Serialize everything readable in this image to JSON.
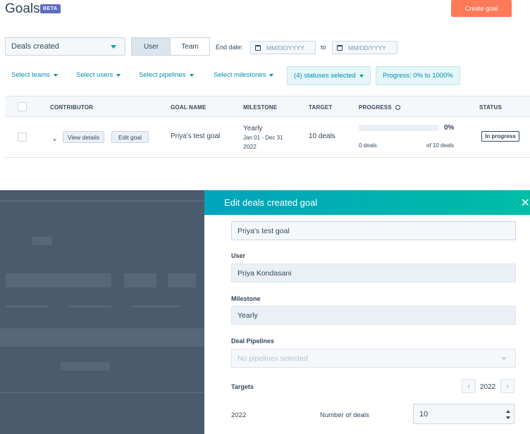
{
  "header": {
    "title": "Goals",
    "badge": "BETA",
    "create_label": "Create goal"
  },
  "filters": {
    "goal_type": "Deals created",
    "segment": {
      "user": "User",
      "team": "Team"
    },
    "end_date_label": "End date:",
    "date_placeholder": "MM/DD/YYYY",
    "to_label": "to",
    "select_teams": "Select teams",
    "select_users": "Select users",
    "select_pipelines": "Select pipelines",
    "select_milestones": "Select milestones",
    "statuses": "(4) statuses selected",
    "progress": "Progress: 0% to 1000%"
  },
  "table": {
    "headers": {
      "contributor": "CONTRIBUTOR",
      "goal_name": "GOAL NAME",
      "milestone": "MILESTONE",
      "target": "TARGET",
      "progress": "PROGRESS",
      "status": "STATUS"
    },
    "row": {
      "view_details": "View details",
      "edit_goal": "Edit goal",
      "goal_name": "Priya's test goal",
      "milestone": "Yearly",
      "milestone_range": "Jan 01 - Dec 31",
      "milestone_year": "2022",
      "target": "10 deals",
      "progress_pct": "0%",
      "progress_fraction": 0,
      "progress_left": "0 deals",
      "progress_right": "of 10 deals",
      "status": "In progress"
    }
  },
  "modal": {
    "title": "Edit deals created goal",
    "goal_name": "Priya's test goal",
    "user_label": "User",
    "user_value": "Priya Kondasani",
    "milestone_label": "Milestone",
    "milestone_value": "Yearly",
    "pipelines_label": "Deal Pipelines",
    "pipelines_placeholder": "No pipelines selected",
    "targets_label": "Targets",
    "target_year": "2022",
    "row_year": "2022",
    "number_label": "Number of deals",
    "number_value": "10"
  },
  "colors": {
    "accent": "#00a4bd",
    "cta": "#ff7a59",
    "overlay": "#4b5b6e"
  }
}
